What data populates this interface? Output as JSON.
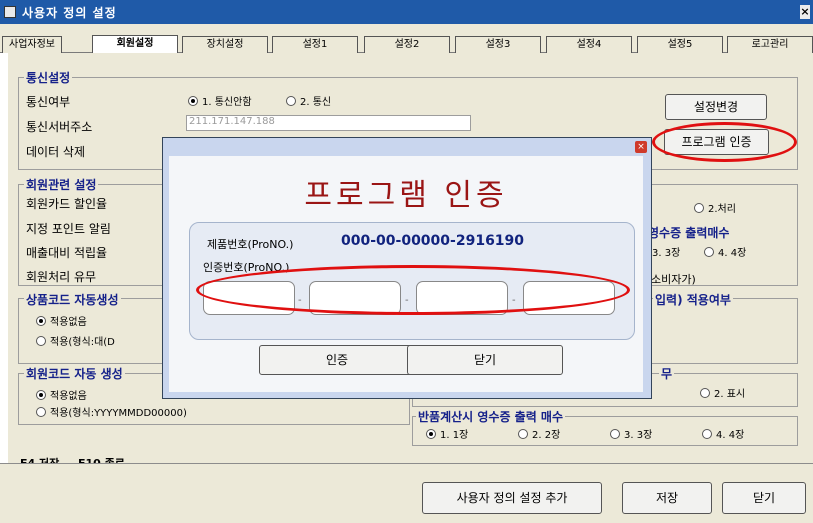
{
  "window": {
    "title": "사용자 정의 설정",
    "close_symbol": "×"
  },
  "tabs": [
    "사업자정보",
    "회원설정",
    "장치설정",
    "설정1",
    "설정2",
    "설정3",
    "설정4",
    "설정5",
    "로고관리"
  ],
  "comm": {
    "title": "통신설정",
    "row1_label": "통신여부",
    "opt1": "1. 통신안함",
    "opt2": "2. 통신",
    "row2_label": "통신서버주소",
    "server_address": "211.171.147.188",
    "row3_label": "데이터 삭제",
    "change_button": "설정변경",
    "program_auth_button": "프로그램 인증"
  },
  "member": {
    "title": "회원관련 설정",
    "row1": "회원카드 할인율",
    "row2": "지정 포인트 알림",
    "row3": "매출대비 적립율",
    "row4": "회원처리 유무",
    "process_opt": "2.처리",
    "receipt_title": "영수증 출력매수",
    "receipt_opt3": "3. 3장",
    "receipt_opt4": "4. 4장",
    "consumer_text": "소비자가)"
  },
  "product_code": {
    "title": "상품코드 자동생성",
    "opt1": "적용없음",
    "opt2": "적용(형식:대(D"
  },
  "input_apply": {
    "title": "입력) 적용여부"
  },
  "member_code": {
    "title": "회원코드 자동 생성",
    "opt1": "적용없음",
    "opt2": "적용(형식:YYYYMMDD00000)"
  },
  "display": {
    "title": "무",
    "opt2": "2. 표시"
  },
  "return_receipt": {
    "title": "반품계산시 영수증 출력 매수",
    "opt1": "1. 1장",
    "opt2": "2. 2장",
    "opt3": "3. 3장",
    "opt4": "4. 4장"
  },
  "hotkeys": {
    "save": "F4 저장",
    "exit": "F10 종료"
  },
  "footer": {
    "add_button": "사용자 정의 설정 추가",
    "save_button": "저장",
    "close_button": "닫기"
  },
  "dialog": {
    "close_symbol": "×",
    "heading": "프로그램 인증",
    "product_label": "제품번호(ProNO.)",
    "product_number": "000-00-00000-2916190",
    "auth_label": "인증번호(ProNO.)",
    "separators": [
      "-",
      "-",
      "-"
    ],
    "auth_button": "인증",
    "close_button": "닫기"
  },
  "colors": {
    "titlebar": "#1f5aa8",
    "group_title": "#15218a",
    "highlight": "#e01010",
    "dialog_frame": "#c9d6ee"
  }
}
